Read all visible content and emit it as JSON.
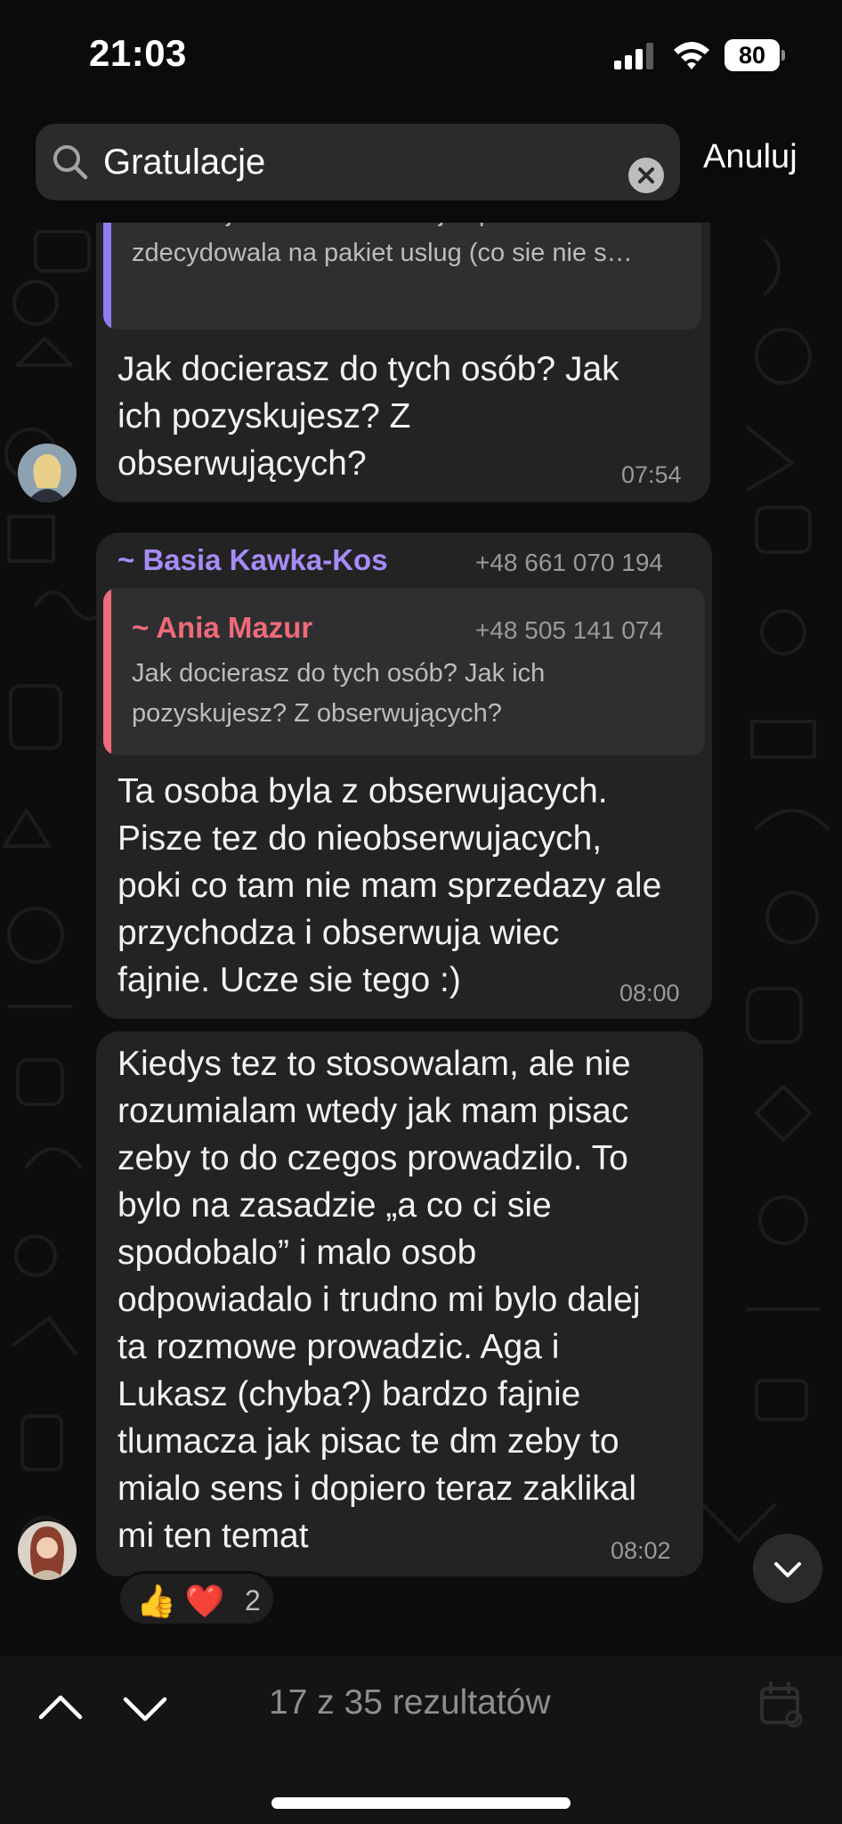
{
  "status_bar": {
    "time": "21:03",
    "battery": "80",
    "icons": [
      "signal-icon",
      "wifi-icon",
      "battery-icon"
    ]
  },
  "search": {
    "query": "Gratulacje",
    "cancel_label": "Anuluj",
    "icons": [
      "search-icon",
      "clear-icon"
    ]
  },
  "messages": [
    {
      "quote_text": "Kochani, zaczelam pisac do ludzi dm na ig\ni wczoraj mialam konsultacje i pani sie\nzdecydowala na pakiet uslug (co sie nie s…",
      "text": "Jak docierasz do tych osób? Jak\nich pozyskujesz? Z\nobserwujących?",
      "time": "07:54",
      "quote_color": "#8e7cf0"
    },
    {
      "sender_name": "~ Basia Kawka-Kos",
      "sender_phone": "+48 661 070 194",
      "sender_color": "#a68cf7",
      "quote_name": "~ Ania Mazur",
      "quote_phone": "+48 505 141 074",
      "quote_color": "#ef6b7a",
      "quote_text": "Jak docierasz do tych osób? Jak ich\npozyskujesz? Z obserwujących?",
      "text": "Ta osoba byla z obserwujacych.\nPisze tez do nieobserwujacych,\npoki co tam nie mam sprzedazy ale\nprzychodza i obserwuja wiec\nfajnie. Ucze sie tego :)",
      "time": "08:00"
    },
    {
      "text": "Kiedys tez to stosowalam, ale nie\nrozumialam wtedy jak mam pisac\nzeby to do czegos prowadzilo. To\nbylo na zasadzie „a co ci sie\nspodobalo” i malo osob\nodpowiadalo i trudno mi bylo dalej\nta rozmowe prowadzic. Aga i\nLukasz (chyba?) bardzo fajnie\ntlumacza jak pisac te dm zeby to\nmialo sens i dopiero teraz zaklikal\nmi ten temat",
      "time": "08:02",
      "reactions": {
        "emojis": "👍 ❤️",
        "count": "2"
      }
    }
  ],
  "bottom_bar": {
    "results": "17 z 35 rezultatów",
    "icons": [
      "chevron-up-icon",
      "chevron-down-icon",
      "calendar-icon"
    ]
  }
}
